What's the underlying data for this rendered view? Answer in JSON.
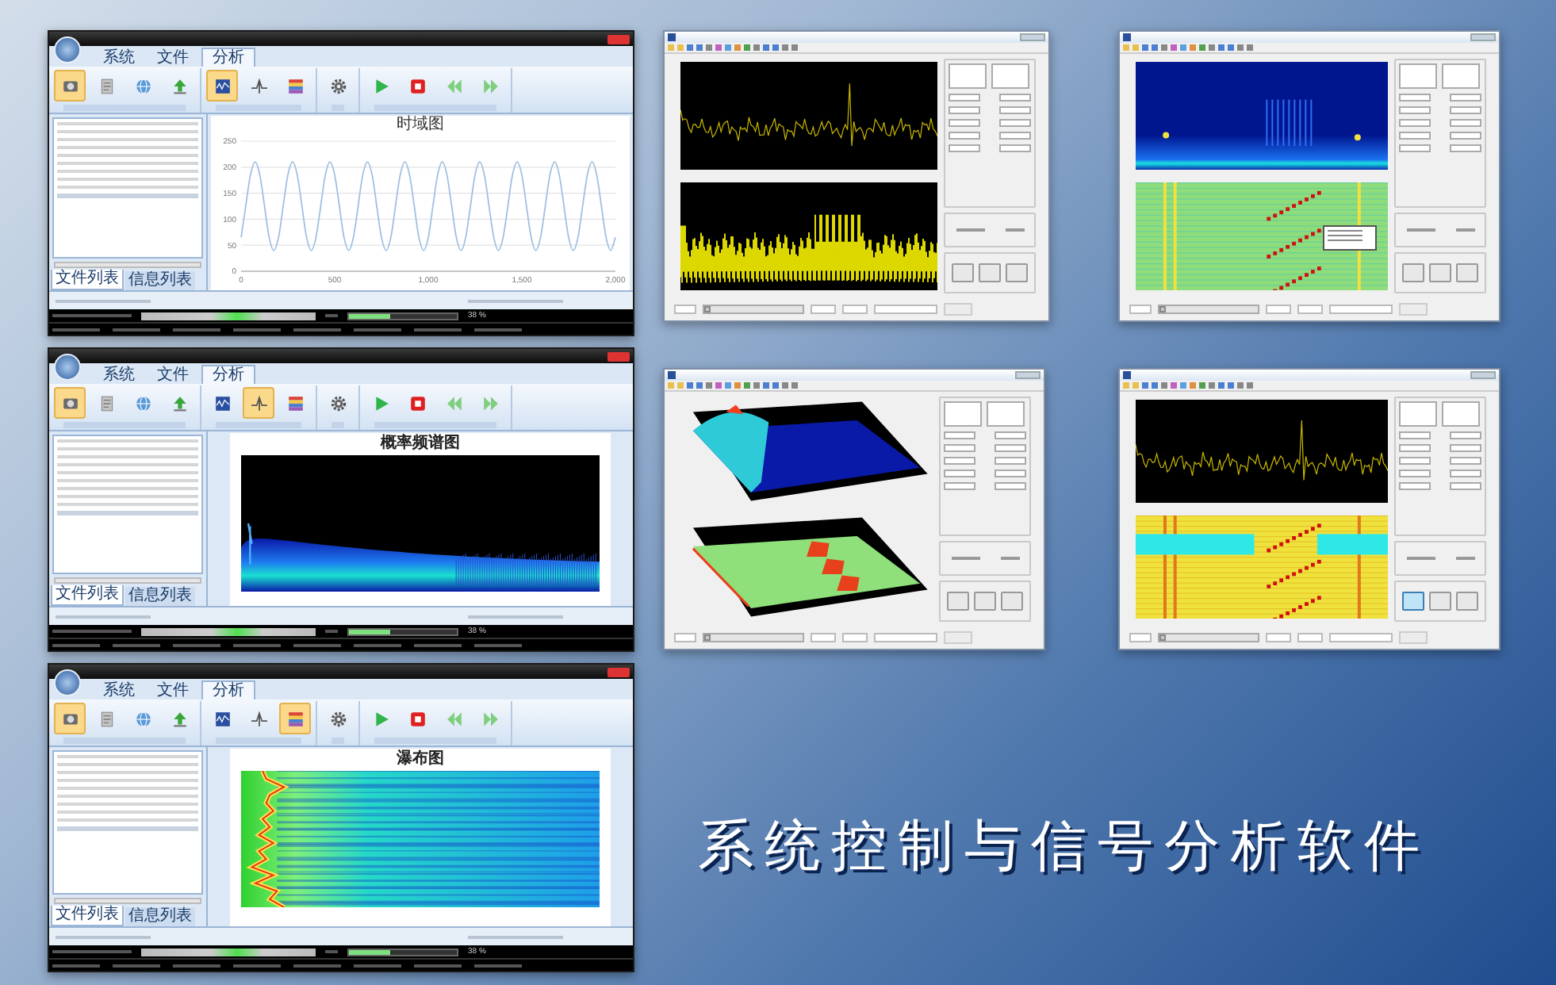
{
  "desktop_title": "系统控制与信号分析软件",
  "app_windows": [
    {
      "tabs": [
        {
          "label": "系统",
          "selected": false
        },
        {
          "label": "文件",
          "selected": false
        },
        {
          "label": "分析",
          "selected": true
        }
      ],
      "ribbon_groups": [
        {
          "buttons": [
            {
              "selected": true
            },
            {
              "selected": false
            },
            {
              "selected": false
            },
            {
              "selected": false
            }
          ]
        },
        {
          "buttons": [
            {
              "selected": true
            },
            {
              "selected": false
            },
            {
              "selected": false
            }
          ]
        },
        {
          "buttons": [
            {
              "selected": false
            }
          ]
        },
        {
          "buttons": [
            {
              "selected": false
            },
            {
              "selected": false
            },
            {
              "selected": false
            },
            {
              "selected": false
            }
          ]
        }
      ],
      "side_tabs": [
        {
          "label": "文件列表",
          "selected": true
        },
        {
          "label": "信息列表",
          "selected": false
        }
      ],
      "plot": {
        "kind": "time",
        "chart_data": {
          "type": "line",
          "title": "时域图",
          "grid": true,
          "x": [
            0,
            25,
            50,
            75,
            100,
            125,
            150,
            175,
            200,
            225,
            250,
            275,
            300,
            325,
            350,
            375,
            400,
            425,
            450,
            475,
            500,
            525,
            550,
            575,
            600,
            625,
            650,
            675,
            700,
            725,
            750,
            775,
            800,
            825,
            850,
            875,
            900,
            925,
            950,
            975,
            1000,
            1025,
            1050,
            1075,
            1100,
            1125,
            1150,
            1175,
            1200,
            1225,
            1250,
            1275,
            1300,
            1325,
            1350,
            1375,
            1400,
            1425,
            1450,
            1475,
            1500,
            1525,
            1550,
            1575,
            1600,
            1625,
            1650,
            1675,
            1700,
            1725,
            1750,
            1775,
            1800,
            1825,
            1850,
            1875,
            1900,
            1925,
            1950,
            1975,
            2000
          ],
          "series": [
            {
              "color": "#9fc0e2",
              "values": [
                65,
                125,
                185,
                210,
                185,
                125,
                65,
                40,
                65,
                125,
                185,
                210,
                185,
                125,
                65,
                40,
                65,
                125,
                185,
                210,
                185,
                125,
                65,
                40,
                65,
                125,
                185,
                210,
                185,
                125,
                65,
                40,
                65,
                125,
                185,
                210,
                185,
                125,
                65,
                40,
                65,
                125,
                185,
                210,
                185,
                125,
                65,
                40,
                65,
                125,
                185,
                210,
                185,
                125,
                65,
                40,
                65,
                125,
                185,
                210,
                185,
                125,
                65,
                40,
                65,
                125,
                185,
                210,
                185,
                125,
                65,
                40,
                65,
                125,
                185,
                210,
                185,
                125,
                65,
                40,
                65
              ]
            }
          ],
          "xlim": [
            0,
            2000
          ],
          "ylim": [
            0,
            250
          ],
          "xticks": [
            0,
            500,
            {
              "value": 1000,
              "label": "1,000"
            },
            {
              "value": 1500,
              "label": "1,500"
            },
            {
              "value": 2000,
              "label": "2,000"
            }
          ],
          "yticks": [
            0,
            50,
            100,
            150,
            200,
            250
          ]
        }
      },
      "progress": {
        "level": 0.38,
        "reading": "38 %"
      }
    },
    {
      "tabs": [
        {
          "label": "系统",
          "selected": false
        },
        {
          "label": "文件",
          "selected": false
        },
        {
          "label": "分析",
          "selected": true
        }
      ],
      "ribbon_groups": [
        {
          "buttons": [
            {
              "selected": true
            },
            {
              "selected": false
            },
            {
              "selected": false
            },
            {
              "selected": false
            }
          ]
        },
        {
          "buttons": [
            {
              "selected": false
            },
            {
              "selected": true
            },
            {
              "selected": false
            }
          ]
        },
        {
          "buttons": [
            {
              "selected": false
            }
          ]
        },
        {
          "buttons": [
            {
              "selected": false
            },
            {
              "selected": false
            },
            {
              "selected": false
            },
            {
              "selected": false
            }
          ]
        }
      ],
      "side_tabs": [
        {
          "label": "文件列表",
          "selected": true
        },
        {
          "label": "信息列表",
          "selected": false
        }
      ],
      "plot": {
        "kind": "spectrum",
        "title": "概率频谱图"
      },
      "progress": {
        "level": 0.38,
        "reading": "38 %"
      }
    },
    {
      "tabs": [
        {
          "label": "系统",
          "selected": false
        },
        {
          "label": "文件",
          "selected": false
        },
        {
          "label": "分析",
          "selected": true
        }
      ],
      "ribbon_groups": [
        {
          "buttons": [
            {
              "selected": true
            },
            {
              "selected": false
            },
            {
              "selected": false
            },
            {
              "selected": false
            }
          ]
        },
        {
          "buttons": [
            {
              "selected": false
            },
            {
              "selected": false
            },
            {
              "selected": true
            }
          ]
        },
        {
          "buttons": [
            {
              "selected": false
            }
          ]
        },
        {
          "buttons": [
            {
              "selected": false
            },
            {
              "selected": false
            },
            {
              "selected": false
            },
            {
              "selected": false
            }
          ]
        }
      ],
      "side_tabs": [
        {
          "label": "文件列表",
          "selected": true
        },
        {
          "label": "信息列表",
          "selected": false
        }
      ],
      "plot": {
        "kind": "waterfall",
        "title": "瀑布图"
      },
      "progress": {
        "level": 0.38,
        "reading": "38 %"
      }
    }
  ],
  "analysis_windows": [
    {
      "top_plot": {
        "kind": "trace"
      },
      "bottom_plot": {
        "kind": "dense-trace"
      },
      "data_tip": false,
      "panel_buttons": [
        {
          "selected": false
        },
        {
          "selected": false
        },
        {
          "selected": false
        }
      ],
      "slider": {
        "level": 0
      }
    },
    {
      "top_plot": {
        "kind": "spectrogram"
      },
      "bottom_plot": {
        "kind": "heatmap"
      },
      "data_tip": true,
      "panel_buttons": [
        {
          "selected": false
        },
        {
          "selected": false
        },
        {
          "selected": false
        }
      ],
      "slider": {
        "level": 0
      }
    },
    {
      "top_plot": {
        "kind": "surface"
      },
      "bottom_plot": {
        "kind": "surface-heat"
      },
      "data_tip": false,
      "panel_buttons": [
        {
          "selected": false
        },
        {
          "selected": false
        },
        {
          "selected": false
        }
      ],
      "slider": {
        "level": 0
      }
    },
    {
      "top_plot": {
        "kind": "trace"
      },
      "bottom_plot": {
        "kind": "heatmap-band"
      },
      "data_tip": false,
      "panel_buttons": [
        {
          "selected": true
        },
        {
          "selected": false
        },
        {
          "selected": false
        }
      ],
      "slider": {
        "level": 0
      }
    }
  ]
}
